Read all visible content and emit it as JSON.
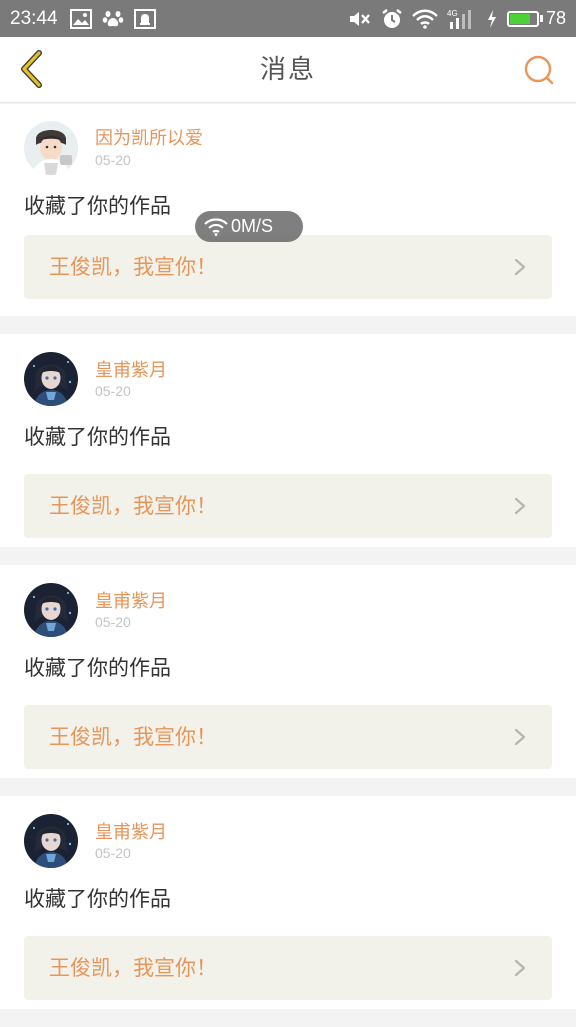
{
  "status_bar": {
    "time": "23:44",
    "battery_percent": "78",
    "battery_level": 0.78,
    "network_label": "4G",
    "left_icons": [
      "image-icon",
      "paw-icon",
      "notification-bell-icon"
    ],
    "right_icons": [
      "mute-icon",
      "alarm-icon",
      "wifi-icon",
      "signal-icon",
      "charging-icon"
    ]
  },
  "header": {
    "title": "消息",
    "back_icon": "chevron-left-icon",
    "search_icon": "search-icon",
    "accent_color": "#e8955a",
    "back_color": "#e3c12a"
  },
  "speed_overlay": {
    "text": "0M/S"
  },
  "messages": [
    {
      "user": "因为凯所以爱",
      "date": "05-20",
      "action": "收藏了你的作品",
      "work_title": "王俊凯，我宣你！",
      "avatar_style": "light"
    },
    {
      "user": "皇甫紫月",
      "date": "05-20",
      "action": "收藏了你的作品",
      "work_title": "王俊凯，我宣你！",
      "avatar_style": "dark"
    },
    {
      "user": "皇甫紫月",
      "date": "05-20",
      "action": "收藏了你的作品",
      "work_title": "王俊凯，我宣你！",
      "avatar_style": "dark"
    },
    {
      "user": "皇甫紫月",
      "date": "05-20",
      "action": "收藏了你的作品",
      "work_title": "王俊凯，我宣你！",
      "avatar_style": "dark"
    }
  ]
}
